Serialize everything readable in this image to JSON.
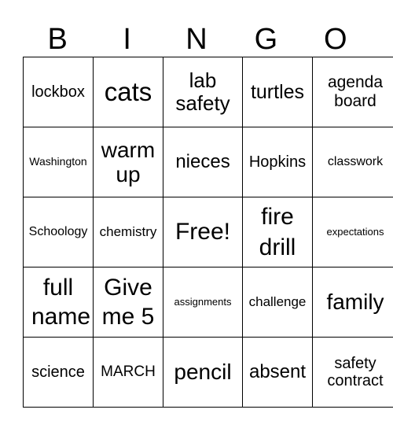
{
  "header": [
    "B",
    "I",
    "N",
    "G",
    "O"
  ],
  "rows": [
    [
      "lockbox",
      "cats",
      "lab safety",
      "turtles",
      "agenda board"
    ],
    [
      "Washington",
      "warm up",
      "nieces",
      "Hopkins",
      "classwork"
    ],
    [
      "Schoology",
      "chemistry",
      "Free!",
      "fire drill",
      "expectations"
    ],
    [
      "full name",
      "Give me 5",
      "assignments",
      "challenge",
      "family"
    ],
    [
      "science",
      "MARCH",
      "pencil",
      "absent",
      "safety contract"
    ]
  ]
}
